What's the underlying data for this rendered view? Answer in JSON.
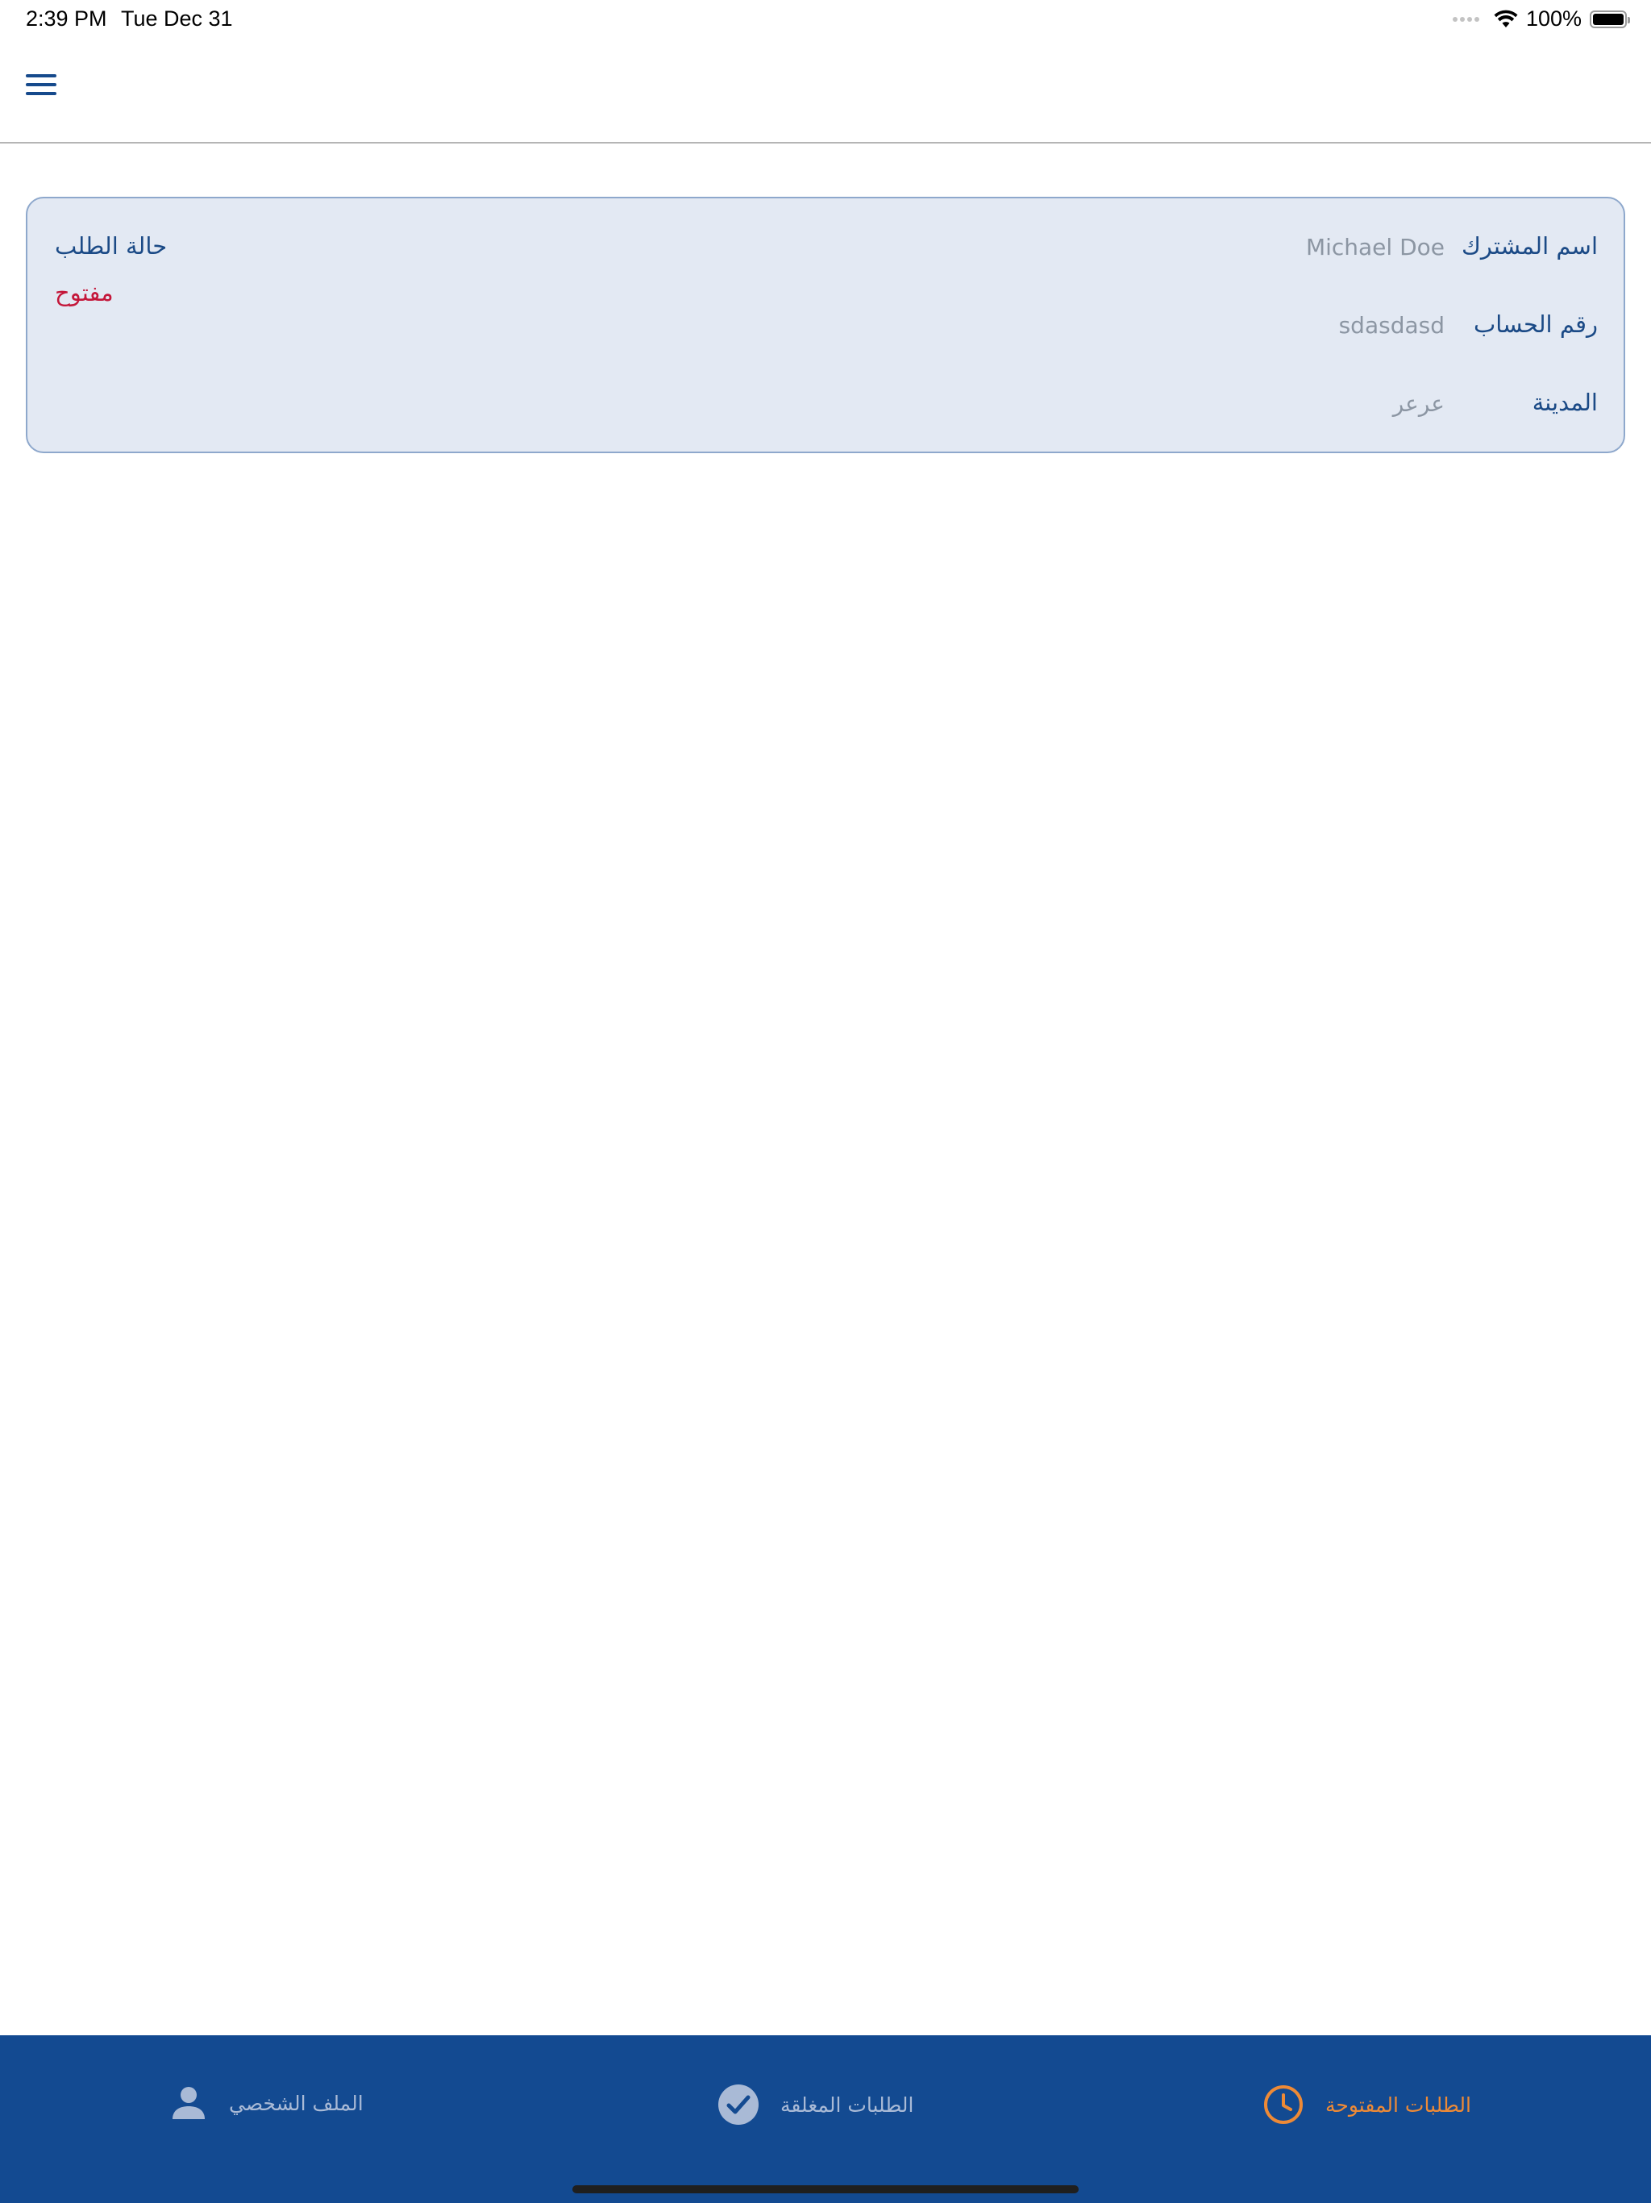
{
  "status_bar": {
    "time": "2:39 PM",
    "date": "Tue Dec 31",
    "battery": "100%"
  },
  "request_card": {
    "subscriber_name_label": "اسم المشترك",
    "subscriber_name_value": "Michael Doe",
    "account_number_label": "رقم الحساب",
    "account_number_value": "sdasdasd",
    "city_label": "المدينة",
    "city_value": "عرعر",
    "request_status_label": "حالة الطلب",
    "request_status_value": "مفتوح"
  },
  "tab_bar": {
    "open_requests": "الطلبات المفتوحة",
    "closed_requests": "الطلبات المغلقة",
    "profile": "الملف الشخصي"
  },
  "colors": {
    "primary": "#134a91",
    "accent": "#ee8a36",
    "status_open": "#c4173a",
    "card_bg": "#e3e9f3"
  }
}
